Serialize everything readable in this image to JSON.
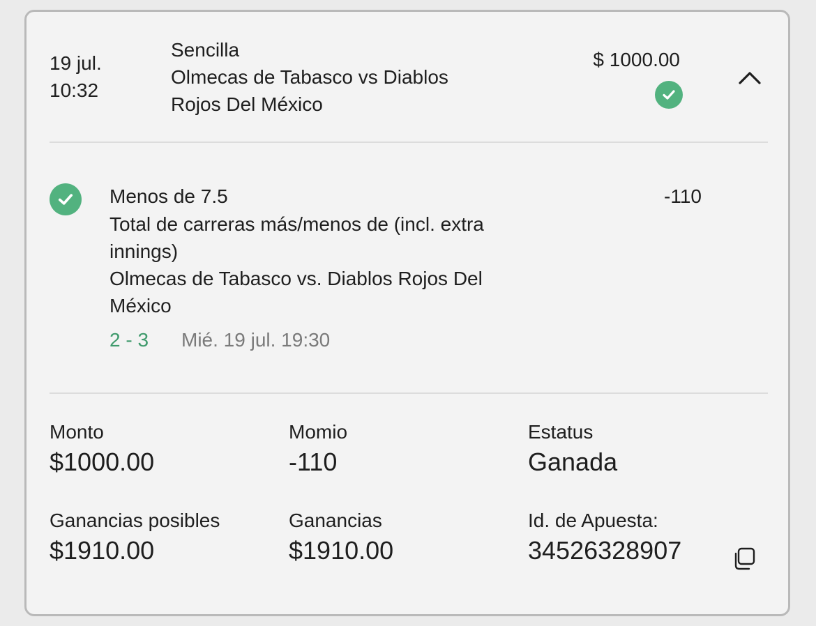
{
  "header": {
    "date": "19 jul.",
    "time": "10:32",
    "bet_type": "Sencilla",
    "event_line1": "Olmecas de Tabasco vs Diablos",
    "event_line2": "Rojos Del México",
    "amount": "$ 1000.00",
    "status_icon": "check-circle-icon",
    "collapse_icon": "chevron-up-icon"
  },
  "selection": {
    "pick": "Menos de 7.5",
    "odds": "-110",
    "market_line1": "Total de carreras más/menos de (incl. extra",
    "market_line2": "innings)",
    "match_line1": "Olmecas de Tabasco vs. Diablos Rojos Del",
    "match_line2": "México",
    "score": "2 - 3",
    "event_datetime": "Mié. 19 jul. 19:30",
    "status_icon": "check-circle-icon"
  },
  "summary": {
    "monto_label": "Monto",
    "monto_value": "$1000.00",
    "momio_label": "Momio",
    "momio_value": "-110",
    "estatus_label": "Estatus",
    "estatus_value": "Ganada",
    "ganancias_posibles_label": "Ganancias posibles",
    "ganancias_posibles_value": "$1910.00",
    "ganancias_label": "Ganancias",
    "ganancias_value": "$1910.00",
    "id_label": "Id. de Apuesta:",
    "id_value": "34526328907",
    "copy_icon": "copy-icon"
  },
  "colors": {
    "success": "#52b27f",
    "score": "#3f9a6c",
    "card_bg": "#f3f3f3",
    "border": "#b9b9b9"
  }
}
